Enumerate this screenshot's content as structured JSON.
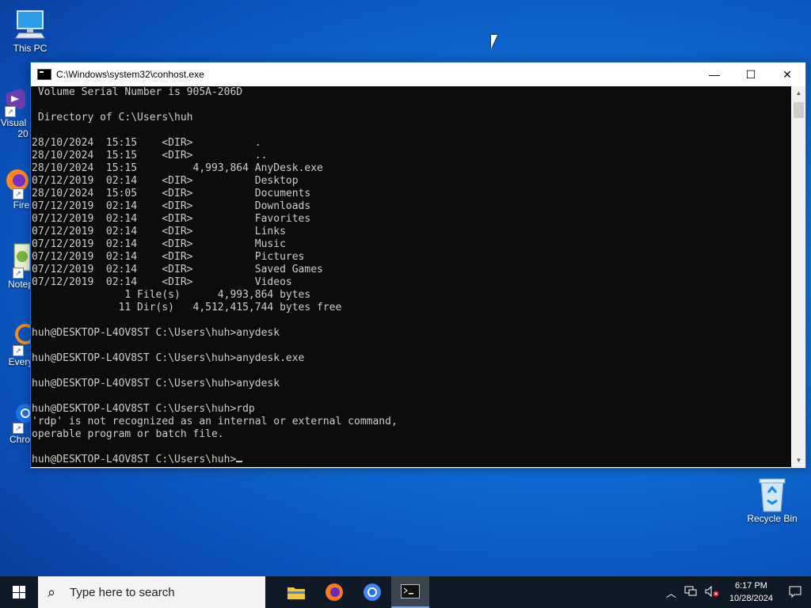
{
  "desktop": {
    "icons": [
      {
        "label": "This PC",
        "icon": "computer-icon"
      },
      {
        "label": "Visual",
        "sub": "20",
        "icon": "visual-studio-icon"
      },
      {
        "label": "Fire",
        "icon": "firefox-icon"
      },
      {
        "label": "Notep",
        "icon": "notepad-icon"
      },
      {
        "label": "Every",
        "icon": "everything-icon"
      },
      {
        "label": "Chron",
        "icon": "chrome-icon"
      },
      {
        "label": "Recycle Bin",
        "icon": "recycle-bin-icon"
      }
    ]
  },
  "window": {
    "title": "C:\\Windows\\system32\\conhost.exe",
    "controls": {
      "minimize": "—",
      "maximize": "☐",
      "close": "✕"
    }
  },
  "console": {
    "lines": [
      " Volume Serial Number is 905A-206D",
      "",
      " Directory of C:\\Users\\huh",
      "",
      "28/10/2024  15:15    <DIR>          .",
      "28/10/2024  15:15    <DIR>          ..",
      "28/10/2024  15:15         4,993,864 AnyDesk.exe",
      "07/12/2019  02:14    <DIR>          Desktop",
      "28/10/2024  15:05    <DIR>          Documents",
      "07/12/2019  02:14    <DIR>          Downloads",
      "07/12/2019  02:14    <DIR>          Favorites",
      "07/12/2019  02:14    <DIR>          Links",
      "07/12/2019  02:14    <DIR>          Music",
      "07/12/2019  02:14    <DIR>          Pictures",
      "07/12/2019  02:14    <DIR>          Saved Games",
      "07/12/2019  02:14    <DIR>          Videos",
      "               1 File(s)      4,993,864 bytes",
      "              11 Dir(s)   4,512,415,744 bytes free",
      "",
      "huh@DESKTOP-L4OV8ST C:\\Users\\huh>anydesk",
      "",
      "huh@DESKTOP-L4OV8ST C:\\Users\\huh>anydesk.exe",
      "",
      "huh@DESKTOP-L4OV8ST C:\\Users\\huh>anydesk",
      "",
      "huh@DESKTOP-L4OV8ST C:\\Users\\huh>rdp",
      "'rdp' is not recognized as an internal or external command,",
      "operable program or batch file.",
      ""
    ],
    "prompt": "huh@DESKTOP-L4OV8ST C:\\Users\\huh>"
  },
  "taskbar": {
    "search_placeholder": "Type here to search",
    "apps": [
      "file-explorer-icon",
      "firefox-icon",
      "chrome-icon",
      "terminal-icon"
    ],
    "time": "6:17 PM",
    "date": "10/28/2024"
  }
}
